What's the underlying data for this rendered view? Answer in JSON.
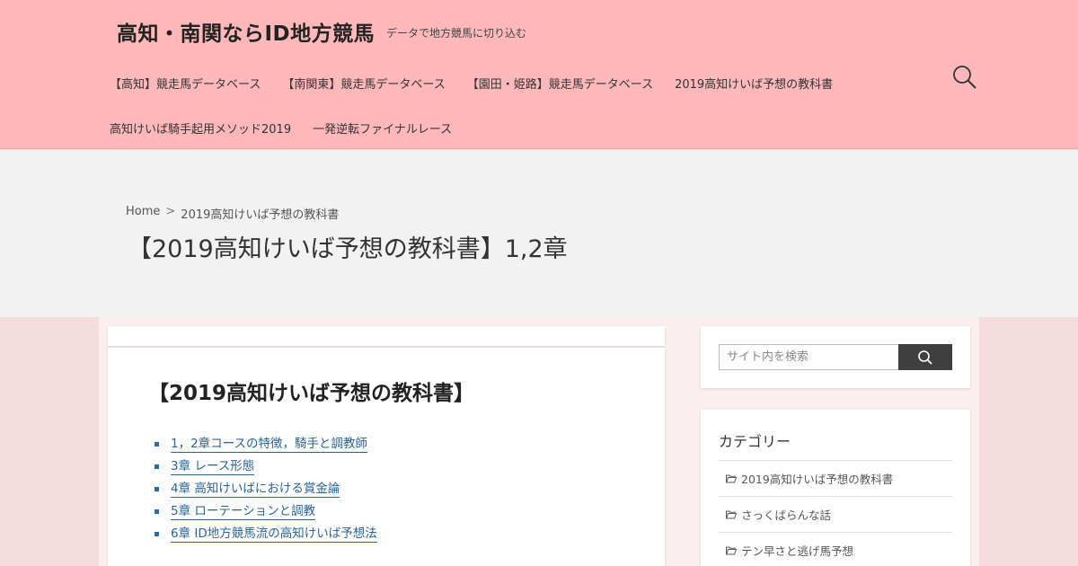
{
  "header": {
    "site_title": "高知・南関ならID地方競馬",
    "tagline": "データで地方競馬に切り込む",
    "nav_row1": [
      {
        "label": "【高知】競走馬データベース"
      },
      {
        "label": "【南関東】競走馬データベース"
      },
      {
        "label": "【園田・姫路】競走馬データベース"
      },
      {
        "label": "2019高知けいば予想の教科書"
      }
    ],
    "nav_row2": [
      {
        "label": "高知けいば騎手起用メソッド2019"
      },
      {
        "label": "一発逆転ファイナルレース"
      }
    ],
    "search_icon": "search-icon"
  },
  "hero": {
    "breadcrumb": {
      "home": "Home",
      "separator": ">",
      "current": "2019高知けいば予想の教科書"
    },
    "title": "【2019高知けいば予想の教科書】1,2章"
  },
  "main": {
    "heading": "【2019高知けいば予想の教科書】",
    "toc": [
      {
        "label": "1，2章コースの特徴，騎手と調教師"
      },
      {
        "label": "3章 レース形態"
      },
      {
        "label": "4章 高知けいばにおける賞金論"
      },
      {
        "label": "5章 ローテーションと調教"
      },
      {
        "label": "6章 ID地方競馬流の高知けいば予想法"
      }
    ]
  },
  "sidebar": {
    "search_placeholder": "サイト内を検索",
    "categories_title": "カテゴリー",
    "categories": [
      {
        "label": "2019高知けいば予想の教科書",
        "icon": "folder-open-icon"
      },
      {
        "label": "さっくばらんな話",
        "icon": "folder-open-icon"
      },
      {
        "label": "テン早さと逃げ馬予想",
        "icon": "folder-open-icon"
      }
    ]
  },
  "colors": {
    "header_bg": "#feb8ba",
    "hero_bg": "#f2f2f2",
    "page_bg": "#f5dcdd",
    "link": "#2a6496",
    "search_button": "#3f3f3f"
  }
}
